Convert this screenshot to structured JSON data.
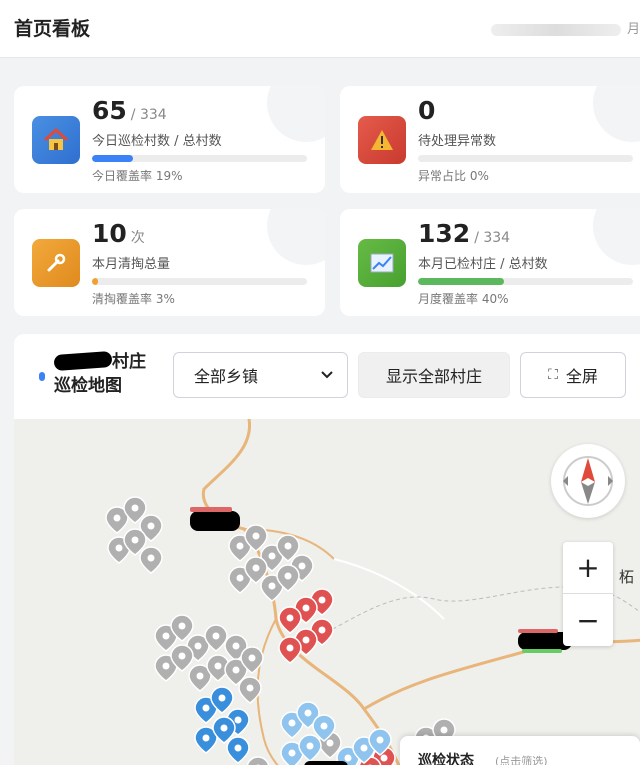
{
  "header": {
    "title": "首页看板",
    "right_text": "月"
  },
  "cards": [
    {
      "value": "65",
      "sub": "/ 334",
      "label": "今日巡检村数 / 总村数",
      "progress": 0.19,
      "foot": "今日覆盖率 19%",
      "color": "#3b82f6",
      "icon": "house-icon"
    },
    {
      "value": "0",
      "sub": "",
      "label": "待处理异常数",
      "progress": 0,
      "foot": "异常占比 0%",
      "color": "#e53e3e",
      "icon": "warning-icon"
    },
    {
      "value": "10",
      "sub": "次",
      "label": "本月清掏总量",
      "progress": 0.03,
      "foot": "清掏覆盖率 3%",
      "color": "#f0a030",
      "icon": "wrench-icon"
    },
    {
      "value": "132",
      "sub": "/ 334",
      "label": "本月已检村庄 / 总村数",
      "progress": 0.4,
      "foot": "月度覆盖率 40%",
      "color": "#5cb85c",
      "icon": "chart-icon"
    }
  ],
  "map": {
    "title_suffix": "村庄",
    "title_line2": "巡检地图",
    "select_value": "全部乡镇",
    "show_all_label": "显示全部村庄",
    "fullscreen_label": "全屏",
    "place_label": "柘",
    "legend_title": "巡检状态",
    "legend_hint": "(点击筛选)",
    "zoom_in": "+",
    "zoom_out": "−"
  }
}
